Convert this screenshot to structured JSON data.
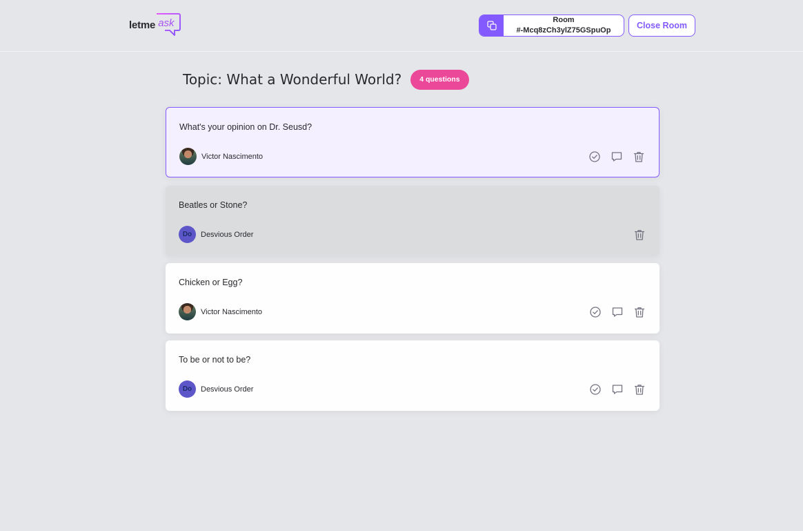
{
  "header": {
    "logo_letme": "letme",
    "logo_ask": "ask",
    "room_label": "Room",
    "room_code": "#-Mcq8zCh3ylZ75GSpuOp",
    "close_button": "Close Room"
  },
  "topic": {
    "title": "Topic: What a Wonderful World?",
    "badge": "4 questions"
  },
  "questions": [
    {
      "content": "What's your opinion on Dr. Seusd?",
      "author": "Victor Nascimento",
      "state": "highlighted"
    },
    {
      "content": "Beatles or Stone?",
      "author": "Desvious Order",
      "state": "answered"
    },
    {
      "content": "Chicken or Egg?",
      "author": "Victor Nascimento",
      "state": "normal"
    },
    {
      "content": "To be or not to be?",
      "author": "Desvious Order",
      "state": "normal"
    }
  ],
  "icons": {
    "copy": "copy-icon",
    "check": "check-circle-icon",
    "answer": "chat-bubble-icon",
    "delete": "trash-icon"
  },
  "colors": {
    "brand": "#835afd",
    "badge": "#ec4899",
    "highlight_bg": "#f4f0ff",
    "answered_bg": "#dbdcdd"
  }
}
